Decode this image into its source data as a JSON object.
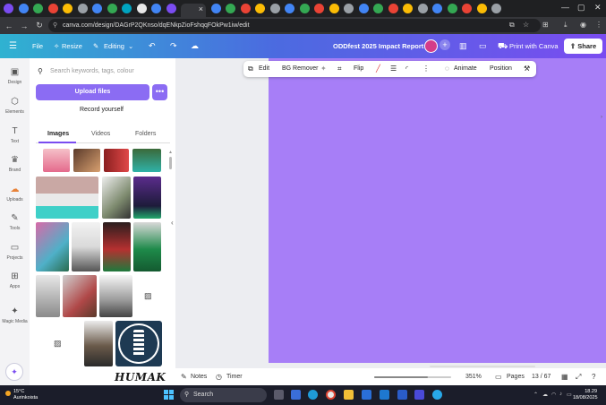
{
  "browser": {
    "tabs": [
      {
        "icon": "canva-icon",
        "color": "#7a4cf0"
      },
      {
        "icon": "site-icon",
        "color": "#4285f4"
      },
      {
        "icon": "site-icon",
        "color": "#34a853"
      },
      {
        "icon": "site-icon",
        "color": "#ea4335"
      },
      {
        "icon": "site-icon",
        "color": "#fbbc05"
      },
      {
        "icon": "site-icon",
        "color": "#9aa0a6"
      },
      {
        "icon": "site-icon",
        "color": "#4285f4"
      },
      {
        "icon": "site-icon",
        "color": "#34a853"
      },
      {
        "icon": "site-icon",
        "color": "#00a3bf"
      },
      {
        "icon": "site-icon",
        "color": "#e8e8e8"
      },
      {
        "icon": "site-icon",
        "color": "#4285f4"
      },
      {
        "icon": "site-icon",
        "color": "#7a4cf0"
      }
    ],
    "url": "canva.com/design/DAGrP2QKnso/dqENkpZioFshqqFOkPw1iw/edit"
  },
  "header": {
    "file": "File",
    "resize": "Resize",
    "mode": "Editing",
    "design_title": "ODDfest 2025 Impact Report",
    "print": "Print with Canva",
    "share": "Share",
    "brand_gradient": [
      "#2fb2d1",
      "#4b6be0",
      "#7a4cf0"
    ]
  },
  "rail": {
    "items": [
      {
        "icon": "design-icon",
        "glyph": "▣",
        "label": "Design"
      },
      {
        "icon": "elements-icon",
        "glyph": "⬡",
        "label": "Elements"
      },
      {
        "icon": "text-icon",
        "glyph": "T",
        "label": "Text"
      },
      {
        "icon": "brand-icon",
        "glyph": "♛",
        "label": "Brand"
      },
      {
        "icon": "uploads-icon",
        "glyph": "☁",
        "label": "Uploads"
      },
      {
        "icon": "tools-icon",
        "glyph": "✎",
        "label": "Tools"
      },
      {
        "icon": "projects-icon",
        "glyph": "▭",
        "label": "Projects"
      },
      {
        "icon": "apps-icon",
        "glyph": "⊞",
        "label": "Apps"
      },
      {
        "icon": "magic-media-icon",
        "glyph": "✦",
        "label": "Magic Media"
      }
    ]
  },
  "panel": {
    "search_placeholder": "Search keywords, tags, colour",
    "upload": "Upload files",
    "more": "•••",
    "record": "Record yourself",
    "tabs": [
      "Images",
      "Videos",
      "Folders"
    ],
    "brand_mark": "HUMAK"
  },
  "toolbar": {
    "edit": "Edit",
    "bg_remover": "BG Remover",
    "flip": "Flip",
    "animate": "Animate",
    "position": "Position"
  },
  "canvas": {
    "page_color": "#a77ef7"
  },
  "footer": {
    "notes": "Notes",
    "timer": "Timer",
    "zoom": "351%",
    "pages": "Pages",
    "page_count": "13 / 67"
  },
  "taskbar": {
    "temperature": "15°C",
    "weather": "Aurinkoista",
    "search": "Search",
    "time": "18.29",
    "date": "18/08/2025"
  }
}
